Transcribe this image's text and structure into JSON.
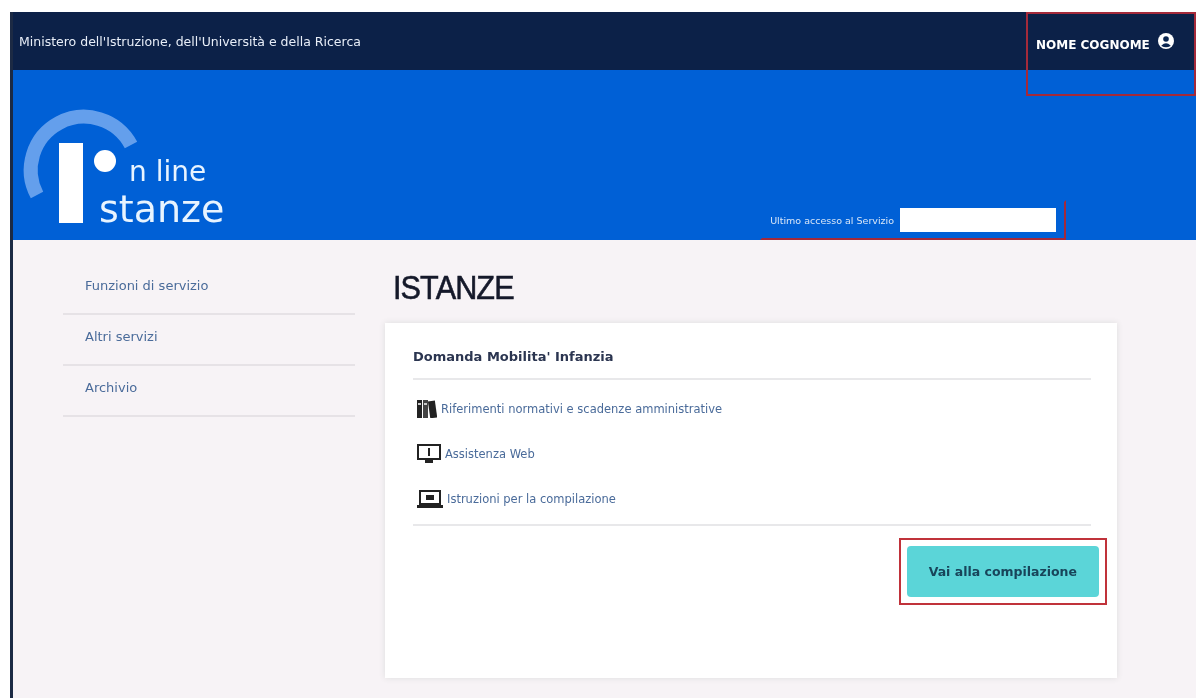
{
  "top_bar": {
    "ministry": "Ministero dell'Istruzione, dell'Università e della Ricerca",
    "user": {
      "name": "NOME COGNOME",
      "highlighted": true
    }
  },
  "banner": {
    "logo": {
      "line1": "n line",
      "line2": "stanze"
    },
    "last_access": {
      "label": "Ultimo accesso al Servizio",
      "highlighted": true
    }
  },
  "sidebar": {
    "items": [
      {
        "label": "Funzioni di servizio"
      },
      {
        "label": "Altri servizi"
      },
      {
        "label": "Archivio"
      }
    ]
  },
  "main": {
    "title": "ISTANZE",
    "card": {
      "title": "Domanda Mobilita' Infanzia",
      "links": [
        {
          "kind": "books",
          "label": "Riferimenti normativi e scadenze amministrative"
        },
        {
          "kind": "monitor",
          "label": "Assistenza Web"
        },
        {
          "kind": "laptop",
          "label": "Istruzioni per la compilazione"
        }
      ],
      "button": {
        "label": "Vai alla compilazione",
        "highlighted": true
      }
    }
  }
}
